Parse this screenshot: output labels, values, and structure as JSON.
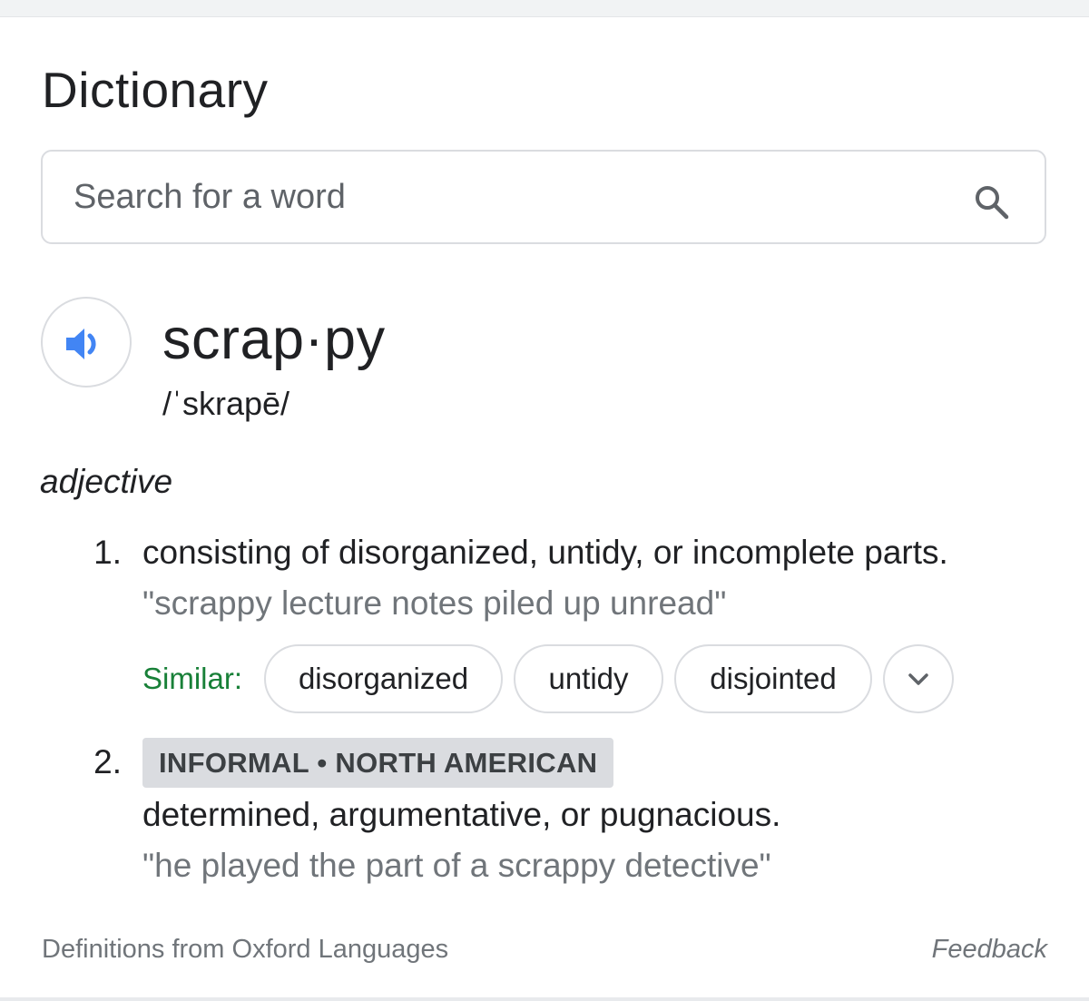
{
  "card": {
    "title": "Dictionary"
  },
  "search": {
    "placeholder": "Search for a word",
    "value": "",
    "icon": "search-icon"
  },
  "entry": {
    "audio_icon": "speaker-icon",
    "headword": "scrap·py",
    "phonetic": "/ˈskrapē/",
    "part_of_speech": "adjective",
    "senses": [
      {
        "number": "1.",
        "definition": "consisting of disorganized, untidy, or incomplete parts.",
        "example": "\"scrappy lecture notes piled up unread\"",
        "similar_label": "Similar:",
        "similar": [
          "disorganized",
          "untidy",
          "disjointed"
        ],
        "more_icon": "chevron-down-icon"
      },
      {
        "number": "2.",
        "register": "INFORMAL • NORTH AMERICAN",
        "definition": "determined, argumentative, or pugnacious.",
        "example": "\"he played the part of a scrappy detective\""
      }
    ]
  },
  "footer": {
    "source": "Definitions from Oxford Languages",
    "feedback": "Feedback"
  },
  "colors": {
    "speaker_icon": "#4285f4",
    "similar_label": "#188038",
    "register_badge_bg": "#dadce0",
    "example_text": "#70757a"
  }
}
